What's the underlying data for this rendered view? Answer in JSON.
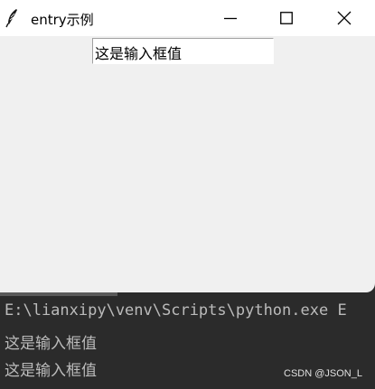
{
  "window": {
    "title": "entry示例",
    "icon": "feather-icon",
    "controls": {
      "minimize": "minimize-icon",
      "maximize": "maximize-icon",
      "close": "close-icon"
    }
  },
  "entry": {
    "value": "这是输入框值"
  },
  "console": {
    "lines": [
      "E:\\lianxipy\\venv\\Scripts\\python.exe E",
      "这是输入框值",
      "这是输入框值"
    ]
  },
  "watermark": "CSDN @JSON_L",
  "colors": {
    "window_bg": "#f0f0f0",
    "titlebar_bg": "#ffffff",
    "console_bg": "#2b2b2b",
    "console_text": "#bbbbbb"
  }
}
